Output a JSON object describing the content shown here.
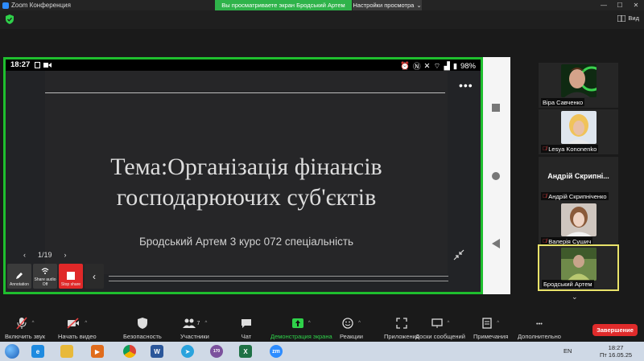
{
  "titlebar": {
    "app_title": "Zoom Конференция",
    "banner": "Вы просматриваете экран Бродський Артем",
    "view_settings": "Настройки просмотра",
    "view_label": "Вид"
  },
  "phone": {
    "time": "18:27",
    "battery": "98%"
  },
  "slide": {
    "title_line1": "Тема:Організація фінансів",
    "title_line2": "господарюючих суб'єктів",
    "subtitle": "Бродський Артем 3 курс 072 спеціальність",
    "page_indicator": "1/19"
  },
  "share_tools": {
    "annotate": "Annotation",
    "share_audio": "Share audio Off",
    "stop_share": "Stop share"
  },
  "participants": [
    {
      "name": "Віра Савченко",
      "muted": false,
      "video": true
    },
    {
      "name": "Lesya Kononenko",
      "muted": true,
      "video": true
    },
    {
      "name": "Андрій Скрипніченко",
      "display": "Андрій Скрипні...",
      "muted": true,
      "video": false
    },
    {
      "name": "Валерія Сушич",
      "muted": true,
      "video": true
    },
    {
      "name": "Бродський Артем",
      "muted": false,
      "video": true
    }
  ],
  "toolbar": {
    "audio": "Включить звук",
    "video": "Начать видео",
    "security": "Безопасность",
    "participants": "Участники",
    "participants_count": "7",
    "chat": "Чат",
    "share": "Демонстрация экрана",
    "reactions": "Реакции",
    "apps": "Приложения",
    "whiteboards": "Доски сообщений",
    "notes": "Примечания",
    "more": "Дополнительно",
    "end": "Завершение"
  },
  "taskbar": {
    "lang": "EN",
    "time": "18:27",
    "date": "Пт 16.05.25",
    "viber_badge": "170"
  },
  "colors": {
    "share_border": "#1fbe2e",
    "end_button": "#e02b2b",
    "stop_share": "#e02828",
    "speaking_border": "#e9e36a"
  }
}
